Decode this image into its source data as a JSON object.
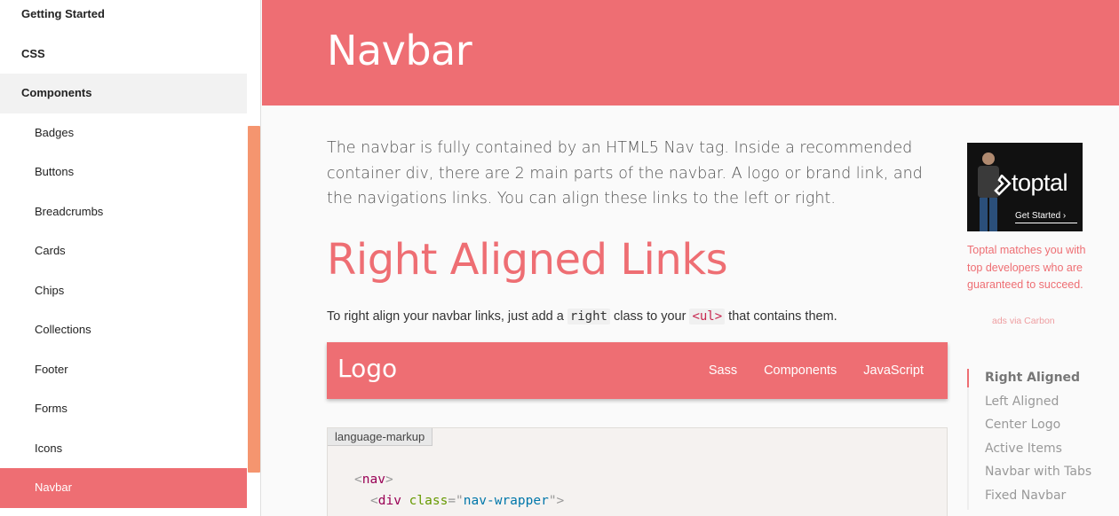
{
  "sidebar": {
    "items": [
      {
        "label": "Getting Started",
        "level": "top"
      },
      {
        "label": "CSS",
        "level": "top"
      },
      {
        "label": "Components",
        "level": "top",
        "expanded": true
      },
      {
        "label": "Badges",
        "level": "sub"
      },
      {
        "label": "Buttons",
        "level": "sub"
      },
      {
        "label": "Breadcrumbs",
        "level": "sub"
      },
      {
        "label": "Cards",
        "level": "sub"
      },
      {
        "label": "Chips",
        "level": "sub"
      },
      {
        "label": "Collections",
        "level": "sub"
      },
      {
        "label": "Footer",
        "level": "sub"
      },
      {
        "label": "Forms",
        "level": "sub"
      },
      {
        "label": "Icons",
        "level": "sub"
      },
      {
        "label": "Navbar",
        "level": "sub",
        "active": true
      }
    ]
  },
  "header": {
    "title": "Navbar"
  },
  "main": {
    "intro": "The navbar is fully contained by an HTML5 Nav tag. Inside a recommended container div, there are 2 main parts of the navbar. A logo or brand link, and the navigations links. You can align these links to the left or right.",
    "section_title": "Right Aligned Links",
    "desc_before": "To right align your navbar links, just add a ",
    "desc_code1": "right",
    "desc_middle": " class to your ",
    "desc_code2": "<ul>",
    "desc_after": " that contains them.",
    "demo_navbar": {
      "logo": "Logo",
      "links": [
        "Sass",
        "Components",
        "JavaScript"
      ]
    },
    "code": {
      "label": "language-markup",
      "line1_open": "<",
      "line1_tag": "nav",
      "line1_close": ">",
      "line2_open": "<",
      "line2_tag": "div",
      "line2_attr": "class",
      "line2_eq": "=\"",
      "line2_value": "nav-wrapper",
      "line2_end": "\">"
    }
  },
  "ad": {
    "brand": "toptal",
    "cta": "Get Started ›",
    "text": "Toptal matches you with top developers who are guaranteed to succeed.",
    "via": "ads via Carbon"
  },
  "toc": {
    "items": [
      "Right Aligned",
      "Left Aligned",
      "Center Logo",
      "Active Items",
      "Navbar with Tabs",
      "Fixed Navbar"
    ]
  },
  "colors": {
    "accent": "#ee6e73",
    "scrollbar": "#f5956f"
  }
}
